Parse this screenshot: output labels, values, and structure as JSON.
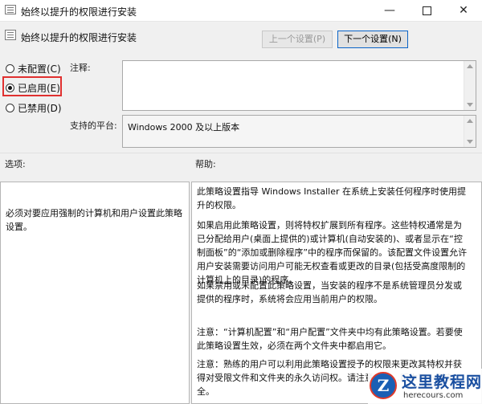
{
  "window": {
    "title": "始终以提升的权限进行安装",
    "minimize_glyph": "—",
    "close_glyph": "✕"
  },
  "header": {
    "policy_name": "始终以提升的权限进行安装",
    "prev_label": "上一个设置(P)",
    "next_label": "下一个设置(N)"
  },
  "state": {
    "options": [
      {
        "label": "未配置(C)",
        "checked": false
      },
      {
        "label": "已启用(E)",
        "checked": true
      },
      {
        "label": "已禁用(D)",
        "checked": false
      }
    ],
    "highlight_color": "#e0302f"
  },
  "comment": {
    "label": "注释:",
    "value": ""
  },
  "platform": {
    "label": "支持的平台:",
    "value": "Windows 2000 及以上版本"
  },
  "options_panel": {
    "label": "选项:",
    "text": "必须对要应用强制的计算机和用户设置此策略设置。"
  },
  "help_panel": {
    "label": "帮助:",
    "paragraphs": [
      "此策略设置指导 Windows Installer 在系统上安装任何程序时使用提升的权限。",
      "如果启用此策略设置，则将特权扩展到所有程序。这些特权通常是为已分配给用户(桌面上提供的)或计算机(自动安装的)、或者显示在“控制面板”的“添加或删除程序”中的程序而保留的。该配置文件设置允许用户安装需要访问用户可能无权查看或更改的目录(包括受高度限制的计算机上的目录)的程序。",
      "如果禁用或未配置此策略设置，当安装的程序不是系统管理员分发或提供的程序时，系统将会应用当前用户的权限。",
      "注意：“计算机配置”和“用户配置”文件夹中均有此策略设置。若要使此策略设置生效，必须在两个文件夹中都启用它。",
      "注意：熟练的用户可以利用此策略设置授予的权限来更改其特权并获得对受限文件和文件夹的永久访问权。请注意，这…版本不一定安全。"
    ]
  },
  "watermark": {
    "badge": "Z",
    "title": "这里教程网",
    "url": "herecours.com"
  }
}
